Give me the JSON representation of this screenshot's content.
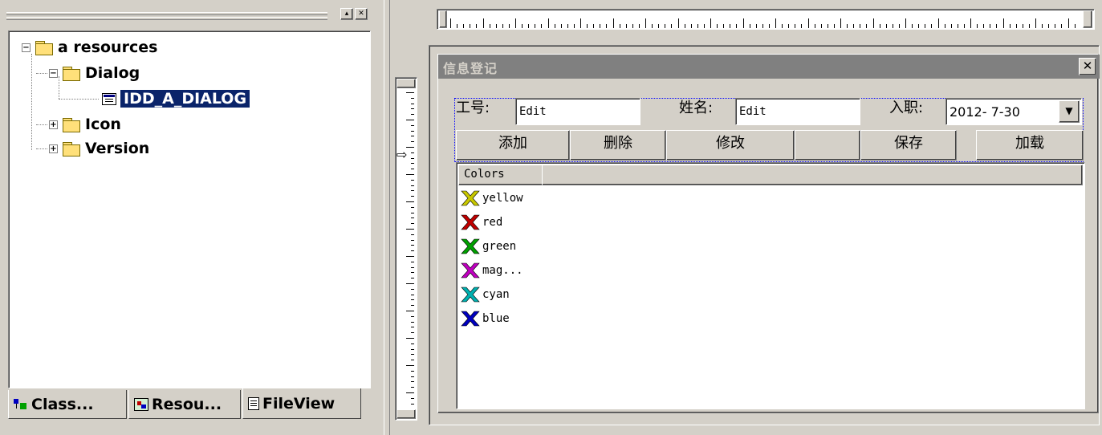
{
  "workspace": {
    "tree": {
      "root": "a resources",
      "dialog_folder": "Dialog",
      "dialog_item": "IDD_A_DIALOG",
      "icon_folder": "Icon",
      "version_folder": "Version",
      "expander_open": "−",
      "expander_closed": "+"
    },
    "tabs": [
      {
        "label": "Class...",
        "icon": "class-view-icon"
      },
      {
        "label": "Resou...",
        "icon": "resource-view-icon"
      },
      {
        "label": "FileView",
        "icon": "file-view-icon"
      }
    ],
    "pane_min_glyph": "▴",
    "pane_close_glyph": "✕"
  },
  "dialog": {
    "title": "信息登记",
    "close_glyph": "✕",
    "labels": {
      "emp_no": "工号:",
      "name": "姓名:",
      "hire_date": "入职:"
    },
    "edit_emp_no": "Edit",
    "edit_name": "Edit",
    "hire_date_value": "2012- 7-30",
    "combo_arrow": "▼",
    "buttons": {
      "add": "添加",
      "delete": "删除",
      "modify": "修改",
      "save": "保存",
      "load": "加载"
    },
    "list": {
      "column": "Colors",
      "items": [
        {
          "label": "yellow",
          "color": "#c8c800"
        },
        {
          "label": "red",
          "color": "#c00000"
        },
        {
          "label": "green",
          "color": "#00a000"
        },
        {
          "label": "mag...",
          "color": "#c000c0"
        },
        {
          "label": "cyan",
          "color": "#00b0b0"
        },
        {
          "label": "blue",
          "color": "#0000c0"
        }
      ]
    }
  },
  "ruler": {
    "marker_glyph": "⇨"
  }
}
